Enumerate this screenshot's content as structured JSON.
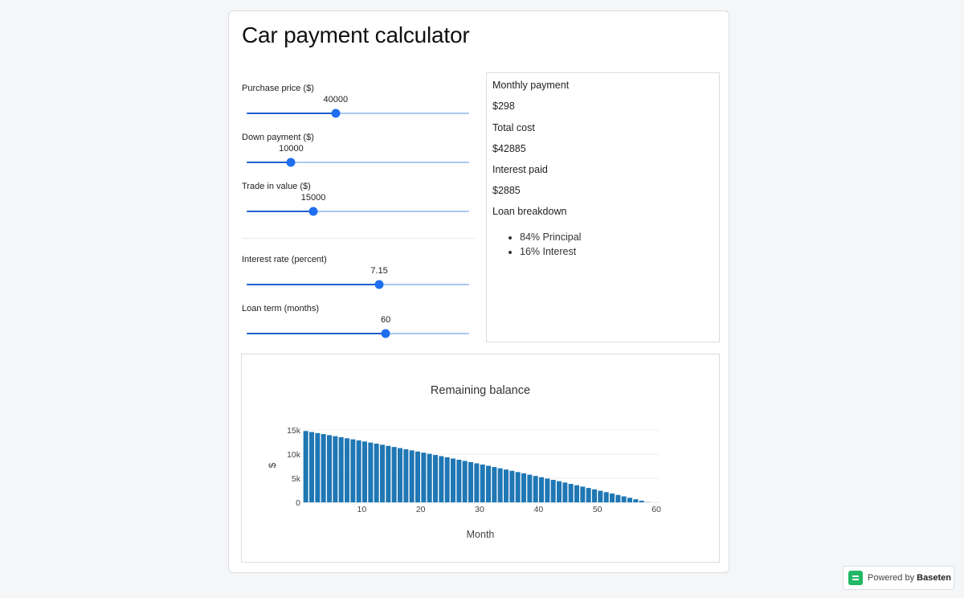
{
  "app": {
    "title": "Car payment calculator"
  },
  "inputs": [
    {
      "label": "Purchase price ($)",
      "value": "40000",
      "fraction": 0.4
    },
    {
      "label": "Down payment ($)",
      "value": "10000",
      "fraction": 0.2
    },
    {
      "label": "Trade in value ($)",
      "value": "15000",
      "fraction": 0.3
    }
  ],
  "loan_inputs": [
    {
      "label": "Interest rate (percent)",
      "value": "7.15",
      "fraction": 0.596
    },
    {
      "label": "Loan term (months)",
      "value": "60",
      "fraction": 0.625
    }
  ],
  "results": {
    "monthly_label": "Monthly payment",
    "monthly_value": "$298",
    "total_label": "Total cost",
    "total_value": "$42885",
    "interest_label": "Interest paid",
    "interest_value": "$2885",
    "breakdown_label": "Loan breakdown",
    "breakdown_items": [
      "84% Principal",
      "16% Interest"
    ]
  },
  "chart_data": {
    "type": "bar",
    "title": "Remaining balance",
    "xlabel": "Month",
    "ylabel": "$",
    "xlim": [
      0,
      60
    ],
    "ylim": [
      0,
      15000
    ],
    "x_ticks": [
      "10",
      "20",
      "30",
      "40",
      "50",
      "60"
    ],
    "y_ticks": [
      "0",
      "5k",
      "10k",
      "15k"
    ],
    "color": "#1f77b4",
    "x": [
      1,
      2,
      3,
      4,
      5,
      6,
      7,
      8,
      9,
      10,
      11,
      12,
      13,
      14,
      15,
      16,
      17,
      18,
      19,
      20,
      21,
      22,
      23,
      24,
      25,
      26,
      27,
      28,
      29,
      30,
      31,
      32,
      33,
      34,
      35,
      36,
      37,
      38,
      39,
      40,
      41,
      42,
      43,
      44,
      45,
      46,
      47,
      48,
      49,
      50,
      51,
      52,
      53,
      54,
      55,
      56,
      57,
      58,
      59,
      60
    ],
    "values": [
      14791,
      14580,
      14368,
      14154,
      13939,
      13723,
      13505,
      13286,
      13065,
      12843,
      12619,
      12394,
      12168,
      11940,
      11711,
      11480,
      11248,
      11014,
      10779,
      10542,
      10304,
      10064,
      9822,
      9580,
      9335,
      9089,
      8842,
      8593,
      8342,
      8090,
      7836,
      7580,
      7323,
      7065,
      6804,
      6542,
      6279,
      6013,
      5746,
      5478,
      5207,
      4935,
      4662,
      4386,
      4109,
      3830,
      3550,
      3267,
      2983,
      2697,
      2410,
      2120,
      1829,
      1536,
      1242,
      945,
      647,
      347,
      45,
      0
    ]
  },
  "footer": {
    "badge_prefix": "Powered by",
    "badge_brand": "Baseten"
  }
}
